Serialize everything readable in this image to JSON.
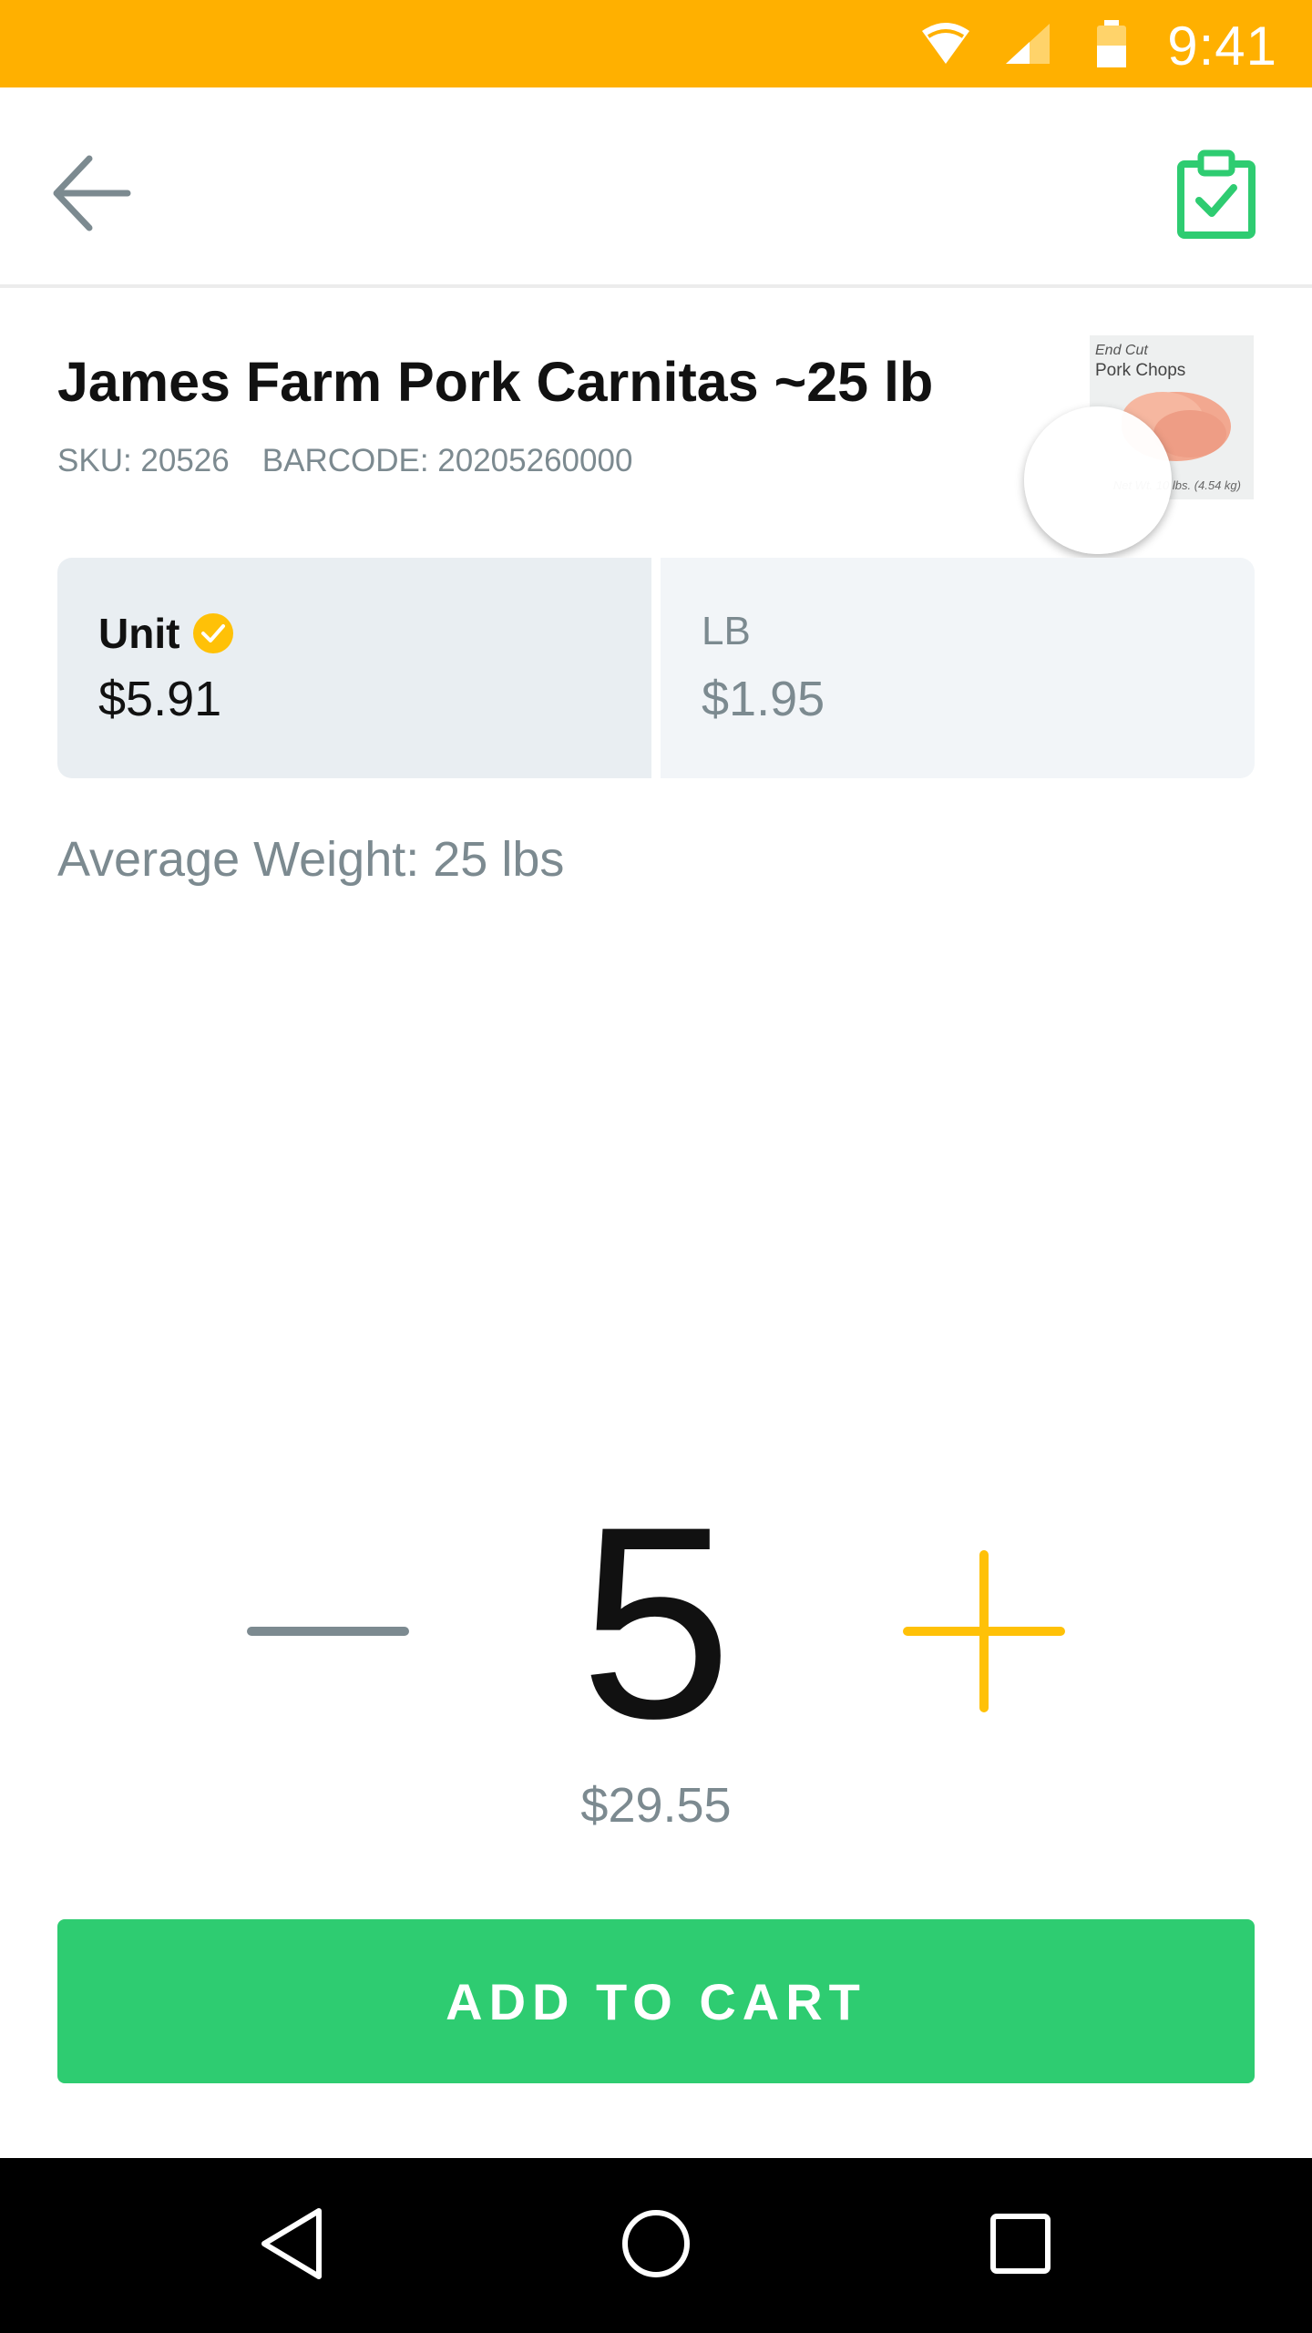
{
  "status_bar": {
    "time": "9:41",
    "icons": [
      "wifi-icon",
      "signal-icon",
      "battery-icon"
    ],
    "color": "#FFB000"
  },
  "app_bar": {
    "back_icon": "arrow-left-icon",
    "action_icon": "clipboard-check-icon",
    "action_color": "#2ECC71"
  },
  "product": {
    "title": "James Farm Pork Carnitas ~25 lb",
    "sku": "SKU: 20526",
    "barcode": "BARCODE: 20205260000",
    "thumbnail": {
      "line1": "End Cut",
      "line2": "Pork Chops",
      "line3": "Net Wt. 10 lbs. (4.54 kg)"
    }
  },
  "price_options": [
    {
      "label": "Unit",
      "price": "$5.91",
      "selected": true
    },
    {
      "label": "LB",
      "price": "$1.95",
      "selected": false
    }
  ],
  "average_weight": "Average Weight: 25 lbs",
  "quantity": {
    "value": "5",
    "total": "$29.55",
    "minus_icon": "minus-icon",
    "plus_icon": "plus-icon",
    "accent_color": "#FFC107"
  },
  "cta": {
    "label": "ADD TO CART",
    "color": "#2ECC71"
  },
  "nav_bar": {
    "icons": [
      "back-triangle-icon",
      "home-circle-icon",
      "recents-square-icon"
    ]
  }
}
